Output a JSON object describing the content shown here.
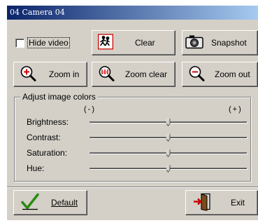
{
  "window": {
    "title": "04 Camera 04"
  },
  "controls": {
    "hide_video_label": "Hide video",
    "hide_video_checked": false,
    "clear_label": "Clear",
    "snapshot_label": "Snapshot",
    "zoom_in_label": "Zoom in",
    "zoom_clear_label": "Zoom clear",
    "zoom_out_label": "Zoom out"
  },
  "adjust": {
    "title": "Adjust image colors",
    "minus_label": "(-)",
    "plus_label": "(+)",
    "sliders": [
      {
        "label": "Brightness:",
        "level": 0.5
      },
      {
        "label": "Contrast:",
        "level": 0.5
      },
      {
        "label": "Saturation:",
        "level": 0.5
      },
      {
        "label": "Hue:",
        "level": 0.5
      }
    ]
  },
  "footer": {
    "default_label": "Default",
    "exit_label": "Exit"
  },
  "icons": {
    "clear": "clear-running-figure-icon",
    "snapshot": "camera-icon",
    "zoom_in": "zoom-in-icon",
    "zoom_clear": "zoom-clear-icon",
    "zoom_out": "zoom-out-icon",
    "default": "checkmark-icon",
    "exit": "exit-door-icon"
  },
  "colors": {
    "titlebar_start": "#0a246a",
    "titlebar_end": "#a6caf0",
    "face": "#d4d0c8",
    "icon_red": "#cc0000",
    "check_green": "#2a8a10"
  }
}
